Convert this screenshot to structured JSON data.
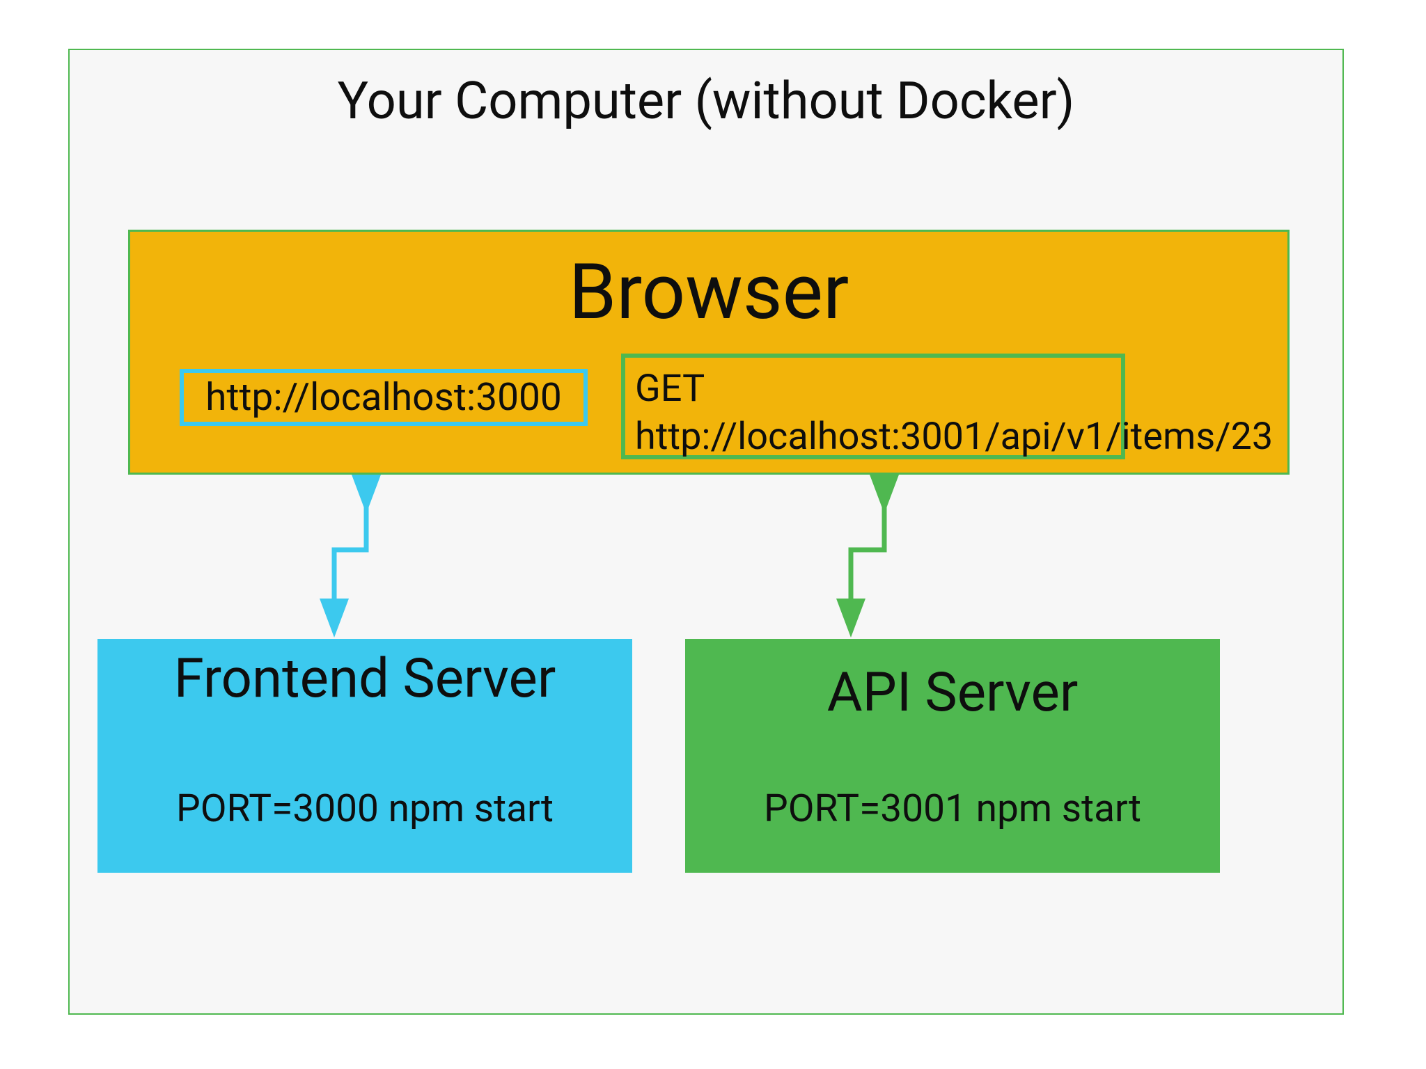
{
  "container": {
    "title": "Your Computer (without Docker)"
  },
  "browser": {
    "title": "Browser",
    "frontend_url": "http://localhost:3000",
    "api_request": "GET http://localhost:3001/api/v1/items/23"
  },
  "frontend_server": {
    "title": "Frontend Server",
    "command": "PORT=3000 npm start"
  },
  "api_server": {
    "title": "API Server",
    "command": "PORT=3001 npm start"
  },
  "colors": {
    "container_border": "#4fb850",
    "container_bg": "#f7f7f7",
    "browser_bg": "#f2b40a",
    "browser_border": "#4fb850",
    "frontend_accent": "#3cc9ee",
    "api_accent": "#4fb850"
  }
}
